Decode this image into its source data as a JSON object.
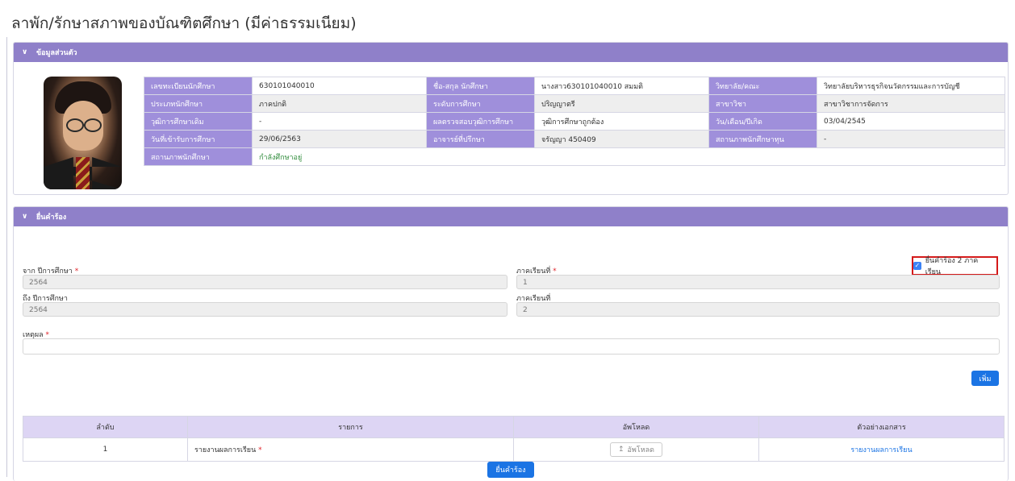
{
  "page": {
    "title": "ลาพัก/รักษาสภาพของบัณฑิตศึกษา (มีค่าธรรมเนียม)"
  },
  "personal": {
    "header": "ข้อมูลส่วนตัว",
    "rows": [
      [
        {
          "label": "เลขทะเบียนนักศึกษา",
          "value": "630101040010"
        },
        {
          "label": "ชื่อ-สกุล นักศึกษา",
          "value": "นางสาว630101040010 สมมติ"
        },
        {
          "label": "วิทยาลัย/คณะ",
          "value": "วิทยาลัยบริหารธุรกิจนวัตกรรมและการบัญชี"
        }
      ],
      [
        {
          "label": "ประเภทนักศึกษา",
          "value": "ภาคปกติ"
        },
        {
          "label": "ระดับการศึกษา",
          "value": "ปริญญาตรี"
        },
        {
          "label": "สาขาวิชา",
          "value": "สาขาวิชาการจัดการ"
        }
      ],
      [
        {
          "label": "วุฒิการศึกษาเดิม",
          "value": "-"
        },
        {
          "label": "ผลตรวจสอบวุฒิการศึกษา",
          "value": "วุฒิการศึกษาถูกต้อง"
        },
        {
          "label": "วัน/เดือน/ปีเกิด",
          "value": "03/04/2545"
        }
      ],
      [
        {
          "label": "วันที่เข้ารับการศึกษา",
          "value": "29/06/2563"
        },
        {
          "label": "อาจารย์ที่ปรึกษา",
          "value": "จรัญญา 450409"
        },
        {
          "label": "สถานภาพนักศึกษาทุน",
          "value": "-"
        }
      ],
      [
        {
          "label": "สถานภาพนักศึกษา",
          "value": "กำลังศึกษาอยู่"
        }
      ]
    ]
  },
  "request": {
    "header": "ยื่นคำร้อง",
    "checkbox_label": "ยื่นคำร้อง 2 ภาคเรียน",
    "checkbox_checked": true,
    "from_year_label": "จาก ปีการศึกษา",
    "from_year_value": "2564",
    "from_term_label": "ภาคเรียนที่",
    "from_term_value": "1",
    "to_year_label": "ถึง ปีการศึกษา",
    "to_year_value": "2564",
    "to_term_label": "ภาคเรียนที่",
    "to_term_value": "2",
    "reason_label": "เหตุผล",
    "reason_value": "",
    "add_button": "เพิ่ม",
    "required_mark": "*",
    "docs_table": {
      "headers": [
        "ลำดับ",
        "รายการ",
        "อัพโหลด",
        "ตัวอย่างเอกสาร"
      ],
      "rows": [
        {
          "no": "1",
          "item": "รายงานผลการเรียน",
          "upload": "อัพโหลด",
          "sample": "รายงานผลการเรียน"
        }
      ]
    },
    "submit_button": "ยื่นคำร้อง"
  }
}
